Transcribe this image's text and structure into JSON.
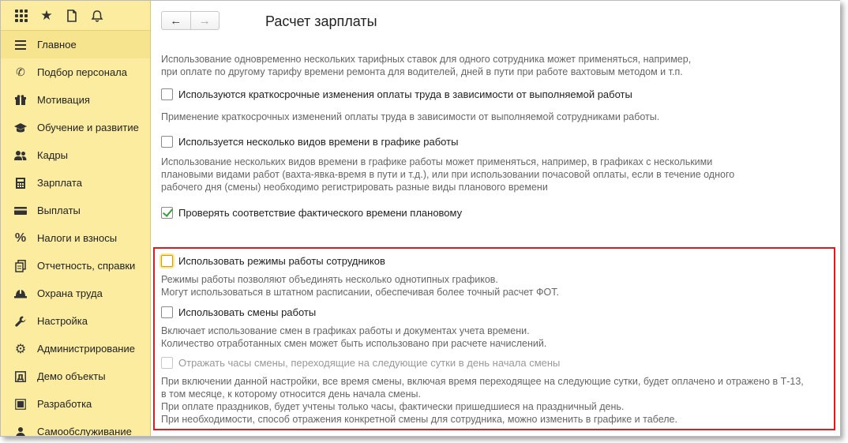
{
  "sidebar": {
    "items": [
      {
        "label": "Главное",
        "icon": "hamburger-menu-icon"
      },
      {
        "label": "Подбор персонала",
        "icon": "phone-icon"
      },
      {
        "label": "Мотивация",
        "icon": "gift-icon"
      },
      {
        "label": "Обучение и развитие",
        "icon": "graduation-cap-icon"
      },
      {
        "label": "Кадры",
        "icon": "people-icon"
      },
      {
        "label": "Зарплата",
        "icon": "calculator-icon"
      },
      {
        "label": "Выплаты",
        "icon": "wallet-icon"
      },
      {
        "label": "Налоги и взносы",
        "icon": "percent-icon"
      },
      {
        "label": "Отчетность, справки",
        "icon": "documents-icon"
      },
      {
        "label": "Охрана труда",
        "icon": "helmet-icon"
      },
      {
        "label": "Настройка",
        "icon": "wrench-icon"
      },
      {
        "label": "Администрирование",
        "icon": "gear-icon"
      },
      {
        "label": "Демо объекты",
        "icon": "demo-icon"
      },
      {
        "label": "Разработка",
        "icon": "black-square-icon"
      },
      {
        "label": "Самообслуживание",
        "icon": "person-icon"
      }
    ]
  },
  "header": {
    "title": "Расчет зарплаты",
    "back": "←",
    "forward": "→"
  },
  "main": {
    "intro": "Использование одновременно нескольких тарифных ставок для одного сотрудника может применяться, например,\nпри оплате по другому тарифу времени ремонта для водителей, дней в пути при работе вахтовым методом и т.п.",
    "opt1_label": "Используются краткосрочные изменения оплаты труда в зависимости от выполняемой работы",
    "opt1_desc": "Применение краткосрочных изменений оплаты труда в зависимости от выполняемой сотрудниками работы.",
    "opt2_label": "Используется несколько видов времени в графике работы",
    "opt2_desc": "Использование нескольких видов времени в графике работы может применяться, например, в графиках с несколькими\nплановыми видами работ (вахта-явка-время в пути и т.д.), или при использовании почасовой оплаты, если в течение одного\nрабочего дня (смены) необходимо регистрировать разные виды планового времени",
    "opt3_label": "Проверять соответствие фактического времени плановому",
    "opt4_label": "Использовать режимы работы сотрудников",
    "opt4_desc": "Режимы работы позволяют объединять несколько однотипных графиков.\nМогут использоваться в штатном расписании, обеспечивая более точный расчет ФОТ.",
    "opt5_label": "Использовать смены работы",
    "opt5_desc": "Включает использование смен в графиках работы и документах учета времени.\nКоличество отработанных смен может быть использовано при расчете начислений.",
    "opt6_label": "Отражать часы смены, переходящие на следующие сутки в день начала смены",
    "opt6_desc": "При включении данной настройки, все время смены, включая время переходящее на следующие сутки, будет оплачено и отражено в Т-13,\nв том месяце, к которому относится день начала смены.\nПри оплате праздников, будет учтены только часы, фактически пришедшиеся на праздничный день.\nПри необходимости, способ отражения конкретной смены для сотрудника, можно изменить в графике и табеле."
  },
  "colors": {
    "sidebar_bg": "#fbec9f",
    "highlight_border": "#e01b1b",
    "check_green": "#3a9c3a"
  }
}
